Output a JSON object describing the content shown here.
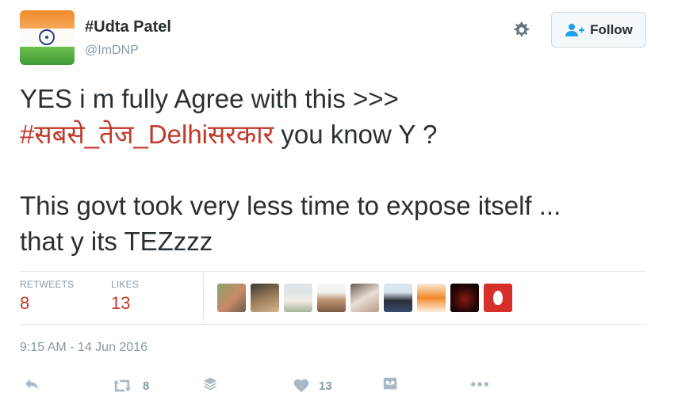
{
  "user": {
    "name": "#Udta Patel",
    "handle": "@ImDNP"
  },
  "follow": {
    "label": "Follow"
  },
  "tweet": {
    "line1": "YES i m fully Agree with this >>>",
    "hashtag": "#सबसे_तेज_Delhiसरकार",
    "line2_rest": " you know Y ?",
    "line3": "This govt took very less time to expose itself ...",
    "line4": "that y its TEZzzz"
  },
  "stats": {
    "retweets_label": "RETWEETS",
    "retweets_value": "8",
    "likes_label": "LIKES",
    "likes_value": "13"
  },
  "timestamp": "9:15 AM - 14 Jun 2016",
  "actions": {
    "retweet_count": "8",
    "like_count": "13"
  },
  "icons": {
    "settings": "gear-icon",
    "follow": "add-user-icon",
    "reply": "reply-icon",
    "retweet": "retweet-icon",
    "stack": "stack-icon",
    "like": "heart-icon",
    "voice": "voicemail-icon",
    "more": "more-icon"
  },
  "colors": {
    "hashtag": "#c0392b",
    "stat_value": "#c0392b",
    "muted": "#8899a6",
    "text": "#292f33",
    "icon_grey": "#aab8c2"
  }
}
